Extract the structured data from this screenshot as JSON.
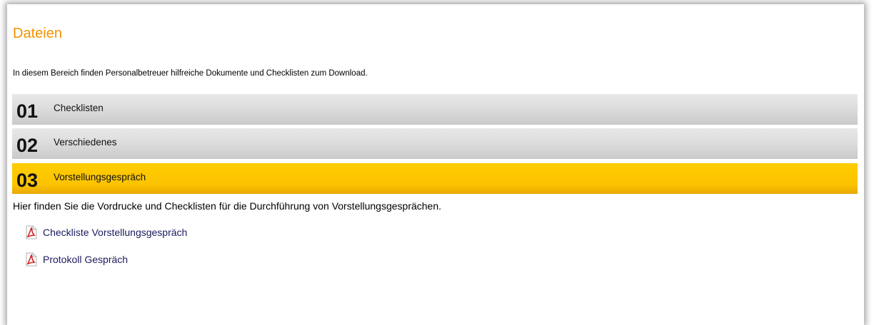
{
  "page": {
    "title": "Dateien",
    "intro": "In diesem Bereich finden Personalbetreuer hilfreiche Dokumente und Checklisten zum Download."
  },
  "sections": [
    {
      "number": "01",
      "label": "Checklisten",
      "state": "collapsed"
    },
    {
      "number": "02",
      "label": "Verschiedenes",
      "state": "collapsed"
    },
    {
      "number": "03",
      "label": "Vorstellungsgespräch",
      "state": "expanded"
    }
  ],
  "expanded_section": {
    "description": "Hier finden Sie die Vordrucke und Checklisten für die Durchführung von Vorstellungsgesprächen.",
    "files": [
      {
        "icon": "pdf-icon",
        "label": "Checkliste Vorstellungsgespräch"
      },
      {
        "icon": "pdf-icon",
        "label": "Protokoll Gespräch"
      }
    ]
  },
  "colors": {
    "title": "#f39200",
    "active_section": "#ffcc00",
    "inactive_section": "#d9d9d9",
    "link": "#1a1a5e"
  }
}
